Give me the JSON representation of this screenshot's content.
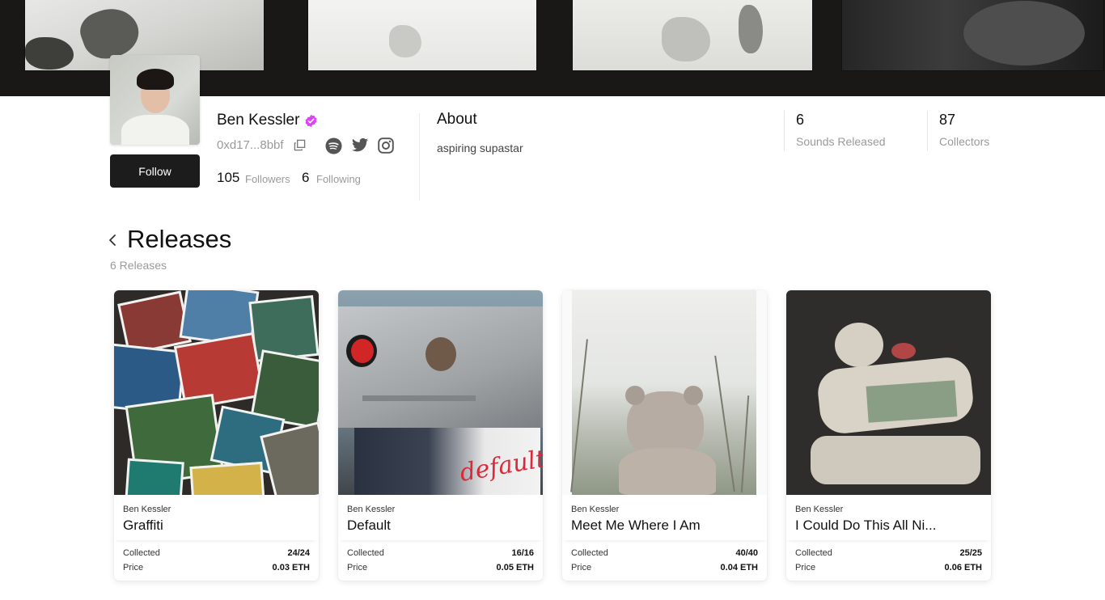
{
  "profile": {
    "name": "Ben Kessler",
    "wallet": "0xd17...8bbf",
    "followers_count": "105",
    "followers_label": "Followers",
    "following_count": "6",
    "following_label": "Following",
    "follow_label": "Follow",
    "verified_color": "#d946ef"
  },
  "about": {
    "title": "About",
    "text": "aspiring supastar"
  },
  "stats": [
    {
      "value": "6",
      "label": "Sounds Released"
    },
    {
      "value": "87",
      "label": "Collectors"
    }
  ],
  "releases": {
    "title": "Releases",
    "count_text": "6 Releases",
    "collected_label": "Collected",
    "price_label": "Price",
    "items": [
      {
        "artist": "Ben Kessler",
        "title": "Graffiti",
        "collected": "24/24",
        "price": "0.03 ETH"
      },
      {
        "artist": "Ben Kessler",
        "title": "Default",
        "collected": "16/16",
        "price": "0.05 ETH",
        "art_text": "default"
      },
      {
        "artist": "Ben Kessler",
        "title": "Meet Me Where I Am",
        "collected": "40/40",
        "price": "0.04 ETH"
      },
      {
        "artist": "Ben Kessler",
        "title": "I Could Do This All Ni...",
        "collected": "25/25",
        "price": "0.06 ETH"
      }
    ]
  },
  "icons": {
    "copy": "copy-icon",
    "spotify": "spotify-icon",
    "twitter": "twitter-icon",
    "instagram": "instagram-icon",
    "back": "chevron-left-icon",
    "verified": "verified-badge-icon"
  }
}
